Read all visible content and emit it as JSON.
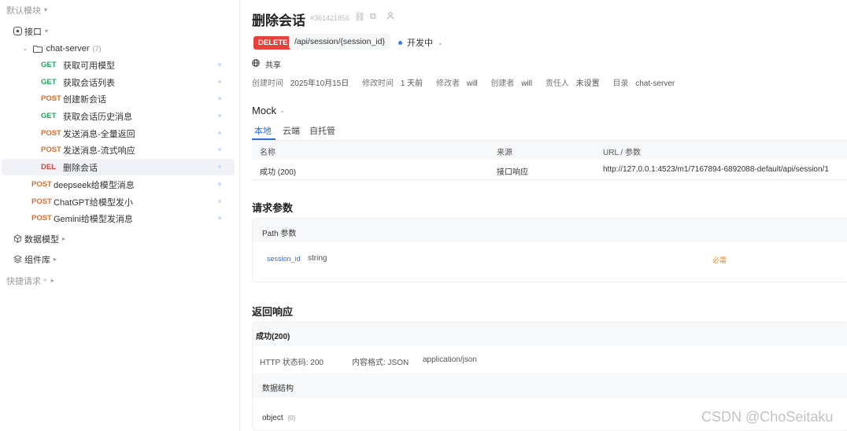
{
  "sidebar": {
    "default_module": "默认模块",
    "interface": "接口",
    "folder": "chat-server",
    "folder_count": "(7)",
    "items": [
      {
        "method": "GET",
        "label": "获取可用模型"
      },
      {
        "method": "GET",
        "label": "获取会话列表"
      },
      {
        "method": "POST",
        "label": "创建新会话"
      },
      {
        "method": "GET",
        "label": "获取会话历史消息"
      },
      {
        "method": "POST",
        "label": "发送消息-全量返回"
      },
      {
        "method": "POST",
        "label": "发送消息-流式响应"
      },
      {
        "method": "DEL",
        "label": "删除会话"
      }
    ],
    "root_items": [
      {
        "method": "POST",
        "label": "deepseek给模型消息"
      },
      {
        "method": "POST",
        "label": "ChatGPT给模型发小"
      },
      {
        "method": "POST",
        "label": "Gemini给模型发消息"
      }
    ],
    "data_models": "数据模型",
    "components": "组件库",
    "quick_requests": "快捷请求"
  },
  "header": {
    "title": "删除会话",
    "id": "#361421856",
    "method": "DELETE",
    "path": "/api/session/{session_id}",
    "status": "开发中",
    "share": "共享"
  },
  "meta": {
    "created_label": "创建时间",
    "created": "2025年10月15日",
    "modified_label": "修改时间",
    "modified": "1 天前",
    "modifier_label": "修改者",
    "modifier": "will",
    "creator_label": "创建者",
    "creator": "will",
    "owner_label": "责任人",
    "owner": "未设置",
    "dir_label": "目录",
    "dir": "chat-server"
  },
  "mock": {
    "title": "Mock",
    "tabs": [
      "本地",
      "云端",
      "自托管"
    ],
    "columns": [
      "名称",
      "来源",
      "URL / 参数"
    ],
    "row": {
      "name": "成功 (200)",
      "source": "接口响应",
      "url": "http://127.0.0.1:4523/m1/7167894-6892088-default/api/session/1"
    }
  },
  "request": {
    "title": "请求参数",
    "path_title": "Path 参数",
    "param_name": "session_id",
    "param_type": "string",
    "param_required": "必需"
  },
  "response": {
    "title": "返回响应",
    "success": "成功(200)",
    "http_label": "HTTP 状态码: 200",
    "content_label": "内容格式: JSON",
    "content_type": "application/json",
    "structure_title": "数据结构",
    "object_label": "object",
    "object_count": "{0}"
  },
  "watermark": "CSDN @ChoSeitaku"
}
